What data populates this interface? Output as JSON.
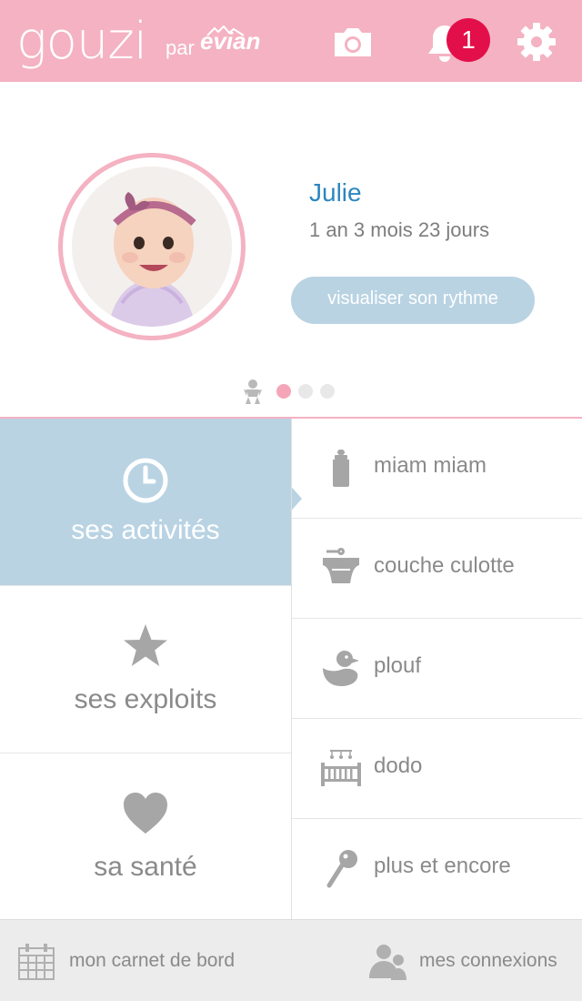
{
  "header": {
    "logo": "gouzi",
    "logo_by": "par",
    "logo_brand": "evian",
    "notifications_count": "1",
    "icons": [
      "camera-icon",
      "bell-icon",
      "gear-icon"
    ],
    "colors": {
      "bar": "#f4b2c2",
      "badge": "#e30f4a"
    }
  },
  "profile": {
    "name": "Julie",
    "age": "1 an 3 mois 23 jours",
    "rhythm_button": "visualiser son rythme",
    "pager": {
      "pages": 3,
      "current": 1
    },
    "colors": {
      "name": "#2d86c0",
      "button": "#b9d3e3"
    }
  },
  "categories": [
    {
      "label": "ses activités",
      "icon": "clock-icon",
      "active": true
    },
    {
      "label": "ses exploits",
      "icon": "star-icon",
      "active": false
    },
    {
      "label": "sa santé",
      "icon": "heart-icon",
      "active": false
    }
  ],
  "activities": [
    {
      "label": "miam miam",
      "icon": "bottle-icon"
    },
    {
      "label": "couche culotte",
      "icon": "diaper-icon"
    },
    {
      "label": "plouf",
      "icon": "duck-icon"
    },
    {
      "label": "dodo",
      "icon": "crib-icon"
    },
    {
      "label": "plus et encore",
      "icon": "rattle-icon"
    }
  ],
  "footer": {
    "left": {
      "label": "mon carnet de bord",
      "icon": "calendar-icon"
    },
    "right": {
      "label": "mes connexions",
      "icon": "people-icon"
    }
  }
}
